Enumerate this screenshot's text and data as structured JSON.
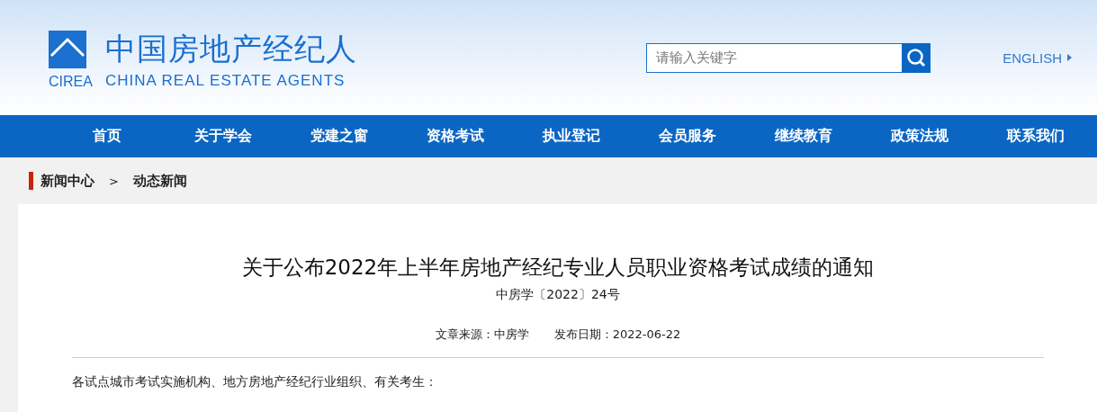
{
  "header": {
    "logo": {
      "name": "中国房地产经纪人",
      "abbr": "CIREA",
      "english": "CHINA REAL ESTATE AGENTS"
    },
    "search": {
      "placeholder": "请输入关键字"
    },
    "language_link": "ENGLISH"
  },
  "nav": [
    "首页",
    "关于学会",
    "党建之窗",
    "资格考试",
    "执业登记",
    "会员服务",
    "继续教育",
    "政策法规",
    "联系我们"
  ],
  "breadcrumb": {
    "items": [
      "新闻中心",
      "动态新闻"
    ],
    "separator": ">"
  },
  "article": {
    "title": "关于公布2022年上半年房地产经纪专业人员职业资格考试成绩的通知",
    "doc_number": "中房学〔2022〕24号",
    "source": "文章来源：中房学",
    "date": "发布日期：2022-06-22",
    "paragraphs": [
      "各试点城市考试实施机构、地方房地产经纪行业组织、有关考生："
    ]
  }
}
